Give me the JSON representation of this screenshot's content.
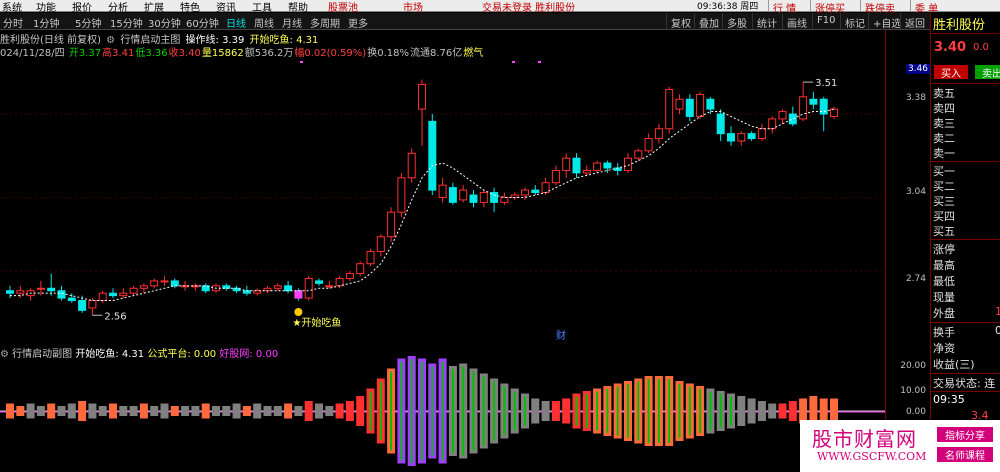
{
  "menu": {
    "items": [
      "系统",
      "功能",
      "报价",
      "分析",
      "扩展",
      "特色",
      "资讯",
      "工具",
      "帮助"
    ],
    "stock_pool": "股票池",
    "market": "市场",
    "status": "交易未登录   胜利股份",
    "clock": "09:36:38 周四",
    "right_buttons": [
      "行 情",
      "涨停买",
      "跌停卖",
      "委 单"
    ]
  },
  "toolbar": {
    "periods": [
      "分时",
      "1分钟",
      "5分钟",
      "15分钟",
      "30分钟",
      "60分钟",
      "日线",
      "周线",
      "月线",
      "多周期",
      "更多"
    ],
    "active_period": "日线",
    "right_tools": [
      "复权",
      "叠加",
      "多股",
      "统计",
      "画线",
      "F10",
      "标记",
      "+自选",
      "返回"
    ]
  },
  "main_chart": {
    "title": "胜利股份(日线 前复权)",
    "indicator": "行情启动主图",
    "op_line_label": "操作线: 3.39",
    "signal_label": "开始吃鱼: 4.31",
    "date": "024/11/28/四",
    "ohlc": [
      {
        "label": "开",
        "value": "3.37",
        "color": "#00d000"
      },
      {
        "label": "高",
        "value": "3.41",
        "color": "#ff4040"
      },
      {
        "label": "低",
        "value": "3.36",
        "color": "#00d000"
      },
      {
        "label": "收",
        "value": "3.40",
        "color": "#ff4040"
      },
      {
        "label": "量",
        "value": "15862",
        "color": "#ffff55"
      },
      {
        "label": "额",
        "value": "536.2万",
        "color": "#c0c0c0"
      },
      {
        "label": "幅",
        "value": "0.02(0.59%)",
        "color": "#ff4040"
      },
      {
        "label": "换",
        "value": "0.18%",
        "color": "#c0c0c0"
      },
      {
        "label": "流通",
        "value": "8.76亿",
        "color": "#c0c0c0"
      },
      {
        "label": "",
        "value": "燃气",
        "color": "#ffff55"
      }
    ],
    "y_ticks": [
      "3.38",
      "3.04",
      "2.74"
    ],
    "current_price_tag": "3.46",
    "annotations": {
      "high": "3.51",
      "low": "2.56",
      "signal": "开始吃鱼",
      "marker": "财"
    }
  },
  "indicator": {
    "title": "行情启动副图",
    "signal": "开始吃鱼: 4.31",
    "platform": "公式平台: 0.00",
    "net": "好股网: 0.00",
    "y_ticks": [
      "20.00",
      "10.00",
      "0.00"
    ]
  },
  "panel": {
    "name": "胜利股份",
    "price": "3.40",
    "change": "0.0",
    "buy": "买入",
    "sell": "卖出",
    "asks": [
      "卖五",
      "卖四",
      "卖三",
      "卖二",
      "卖一"
    ],
    "bids": [
      "买一",
      "买二",
      "买三",
      "买四",
      "买五"
    ],
    "stats": [
      "涨停",
      "最高",
      "最低",
      "现量",
      "外盘"
    ],
    "stat_values": [
      "",
      "",
      "",
      "",
      "1"
    ],
    "extra": [
      "换手",
      "净资",
      "收益(三)"
    ],
    "extra_values": [
      "0",
      "",
      ""
    ],
    "trade_state": "交易状态: 连",
    "time": "09:35",
    "tick_value": "3.4"
  },
  "watermark": {
    "title": "股市财富网",
    "url": "WWW.GSCFW.COM",
    "tag1": "指标分享",
    "tag2": "名师课程"
  },
  "chart_data": {
    "type": "candlestick",
    "y_range": [
      2.5,
      3.6
    ],
    "candles": [
      [
        2.66,
        2.65,
        2.68,
        2.63
      ],
      [
        2.65,
        2.66,
        2.68,
        2.63
      ],
      [
        2.64,
        2.66,
        2.67,
        2.62
      ],
      [
        2.67,
        2.67,
        2.7,
        2.64
      ],
      [
        2.67,
        2.66,
        2.73,
        2.64
      ],
      [
        2.66,
        2.63,
        2.68,
        2.62
      ],
      [
        2.63,
        2.62,
        2.65,
        2.61
      ],
      [
        2.62,
        2.58,
        2.64,
        2.57
      ],
      [
        2.59,
        2.62,
        2.63,
        2.56
      ],
      [
        2.62,
        2.65,
        2.66,
        2.61
      ],
      [
        2.65,
        2.64,
        2.67,
        2.63
      ],
      [
        2.64,
        2.65,
        2.67,
        2.63
      ],
      [
        2.65,
        2.67,
        2.68,
        2.64
      ],
      [
        2.67,
        2.68,
        2.69,
        2.65
      ],
      [
        2.68,
        2.7,
        2.71,
        2.67
      ],
      [
        2.7,
        2.7,
        2.72,
        2.68
      ],
      [
        2.7,
        2.68,
        2.71,
        2.67
      ],
      [
        2.68,
        2.68,
        2.7,
        2.66
      ],
      [
        2.68,
        2.68,
        2.69,
        2.66
      ],
      [
        2.68,
        2.66,
        2.69,
        2.65
      ],
      [
        2.66,
        2.68,
        2.69,
        2.65
      ],
      [
        2.68,
        2.67,
        2.69,
        2.66
      ],
      [
        2.67,
        2.66,
        2.68,
        2.65
      ],
      [
        2.66,
        2.65,
        2.68,
        2.64
      ],
      [
        2.65,
        2.66,
        2.67,
        2.64
      ],
      [
        2.66,
        2.67,
        2.68,
        2.65
      ],
      [
        2.67,
        2.68,
        2.69,
        2.66
      ],
      [
        2.68,
        2.66,
        2.7,
        2.65
      ],
      [
        2.66,
        2.63,
        2.67,
        2.62
      ],
      [
        2.63,
        2.71,
        2.72,
        2.62
      ],
      [
        2.7,
        2.69,
        2.71,
        2.68
      ],
      [
        2.68,
        2.68,
        2.7,
        2.67
      ],
      [
        2.68,
        2.71,
        2.72,
        2.67
      ],
      [
        2.71,
        2.73,
        2.74,
        2.7
      ],
      [
        2.73,
        2.77,
        2.78,
        2.72
      ],
      [
        2.77,
        2.82,
        2.83,
        2.76
      ],
      [
        2.82,
        2.88,
        2.89,
        2.8
      ],
      [
        2.88,
        2.98,
        3.0,
        2.86
      ],
      [
        2.98,
        3.12,
        3.14,
        2.96
      ],
      [
        3.12,
        3.22,
        3.24,
        3.1
      ],
      [
        3.4,
        3.5,
        3.52,
        3.25
      ],
      [
        3.35,
        3.07,
        3.38,
        3.05
      ],
      [
        3.04,
        3.09,
        3.12,
        3.02
      ],
      [
        3.08,
        3.02,
        3.1,
        3.01
      ],
      [
        3.03,
        3.07,
        3.09,
        3.02
      ],
      [
        3.05,
        3.02,
        3.07,
        3.0
      ],
      [
        3.02,
        3.06,
        3.07,
        3.0
      ],
      [
        3.06,
        3.02,
        3.08,
        2.98
      ],
      [
        3.02,
        3.04,
        3.06,
        3.01
      ],
      [
        3.04,
        3.05,
        3.06,
        3.03
      ],
      [
        3.05,
        3.07,
        3.08,
        3.03
      ],
      [
        3.07,
        3.06,
        3.09,
        3.05
      ],
      [
        3.06,
        3.1,
        3.12,
        3.05
      ],
      [
        3.1,
        3.15,
        3.17,
        3.09
      ],
      [
        3.15,
        3.2,
        3.22,
        3.12
      ],
      [
        3.2,
        3.14,
        3.22,
        3.12
      ],
      [
        3.14,
        3.15,
        3.17,
        3.13
      ],
      [
        3.15,
        3.18,
        3.19,
        3.14
      ],
      [
        3.18,
        3.16,
        3.19,
        3.14
      ],
      [
        3.16,
        3.15,
        3.18,
        3.13
      ],
      [
        3.15,
        3.2,
        3.22,
        3.14
      ],
      [
        3.2,
        3.23,
        3.24,
        3.19
      ],
      [
        3.23,
        3.28,
        3.3,
        3.22
      ],
      [
        3.28,
        3.32,
        3.34,
        3.26
      ],
      [
        3.32,
        3.48,
        3.49,
        3.3
      ],
      [
        3.4,
        3.44,
        3.46,
        3.38
      ],
      [
        3.44,
        3.37,
        3.46,
        3.35
      ],
      [
        3.37,
        3.46,
        3.47,
        3.36
      ],
      [
        3.44,
        3.4,
        3.45,
        3.38
      ],
      [
        3.38,
        3.3,
        3.4,
        3.27
      ],
      [
        3.3,
        3.27,
        3.33,
        3.25
      ],
      [
        3.27,
        3.3,
        3.31,
        3.25
      ],
      [
        3.3,
        3.28,
        3.31,
        3.27
      ],
      [
        3.28,
        3.32,
        3.34,
        3.27
      ],
      [
        3.32,
        3.36,
        3.37,
        3.3
      ],
      [
        3.36,
        3.39,
        3.4,
        3.34
      ],
      [
        3.38,
        3.34,
        3.41,
        3.33
      ],
      [
        3.36,
        3.45,
        3.51,
        3.35
      ],
      [
        3.44,
        3.42,
        3.47,
        3.4
      ],
      [
        3.44,
        3.38,
        3.45,
        3.31
      ],
      [
        3.37,
        3.4,
        3.41,
        3.36
      ]
    ],
    "ma": [
      2.64,
      2.64,
      2.65,
      2.65,
      2.65,
      2.65,
      2.64,
      2.63,
      2.62,
      2.62,
      2.62,
      2.63,
      2.64,
      2.65,
      2.66,
      2.67,
      2.68,
      2.68,
      2.68,
      2.68,
      2.67,
      2.67,
      2.67,
      2.66,
      2.66,
      2.66,
      2.66,
      2.66,
      2.66,
      2.66,
      2.67,
      2.67,
      2.68,
      2.69,
      2.7,
      2.73,
      2.77,
      2.84,
      2.93,
      3.03,
      3.12,
      3.17,
      3.18,
      3.16,
      3.13,
      3.1,
      3.07,
      3.05,
      3.04,
      3.04,
      3.04,
      3.05,
      3.06,
      3.08,
      3.1,
      3.12,
      3.13,
      3.14,
      3.15,
      3.16,
      3.17,
      3.19,
      3.21,
      3.24,
      3.28,
      3.31,
      3.34,
      3.37,
      3.39,
      3.39,
      3.37,
      3.35,
      3.33,
      3.32,
      3.32,
      3.34,
      3.36,
      3.38,
      3.39,
      3.39,
      3.4
    ],
    "indicator_range": [
      -10,
      25
    ],
    "osc": [
      [
        3,
        "#ff6a3d"
      ],
      [
        2,
        "#ff6a3d"
      ],
      [
        3,
        "#808080"
      ],
      [
        2,
        "#808080"
      ],
      [
        3,
        "#ff6a3d"
      ],
      [
        2,
        "#808080"
      ],
      [
        3,
        "#808080"
      ],
      [
        4,
        "#ff6a3d"
      ],
      [
        3,
        "#808080"
      ],
      [
        2,
        "#808080"
      ],
      [
        3,
        "#ff6a3d"
      ],
      [
        2,
        "#808080"
      ],
      [
        2,
        "#808080"
      ],
      [
        3,
        "#ff6a3d"
      ],
      [
        2,
        "#808080"
      ],
      [
        3,
        "#808080"
      ],
      [
        2,
        "#ff6a3d"
      ],
      [
        2,
        "#808080"
      ],
      [
        2,
        "#808080"
      ],
      [
        3,
        "#ff6a3d"
      ],
      [
        2,
        "#808080"
      ],
      [
        2,
        "#808080"
      ],
      [
        3,
        "#808080"
      ],
      [
        2,
        "#ff6a3d"
      ],
      [
        3,
        "#808080"
      ],
      [
        2,
        "#808080"
      ],
      [
        2,
        "#808080"
      ],
      [
        3,
        "#ff6a3d"
      ],
      [
        2,
        "#808080"
      ],
      [
        4,
        "#ff3030"
      ],
      [
        3,
        "#808080"
      ],
      [
        2,
        "#808080"
      ],
      [
        3,
        "#ff3030"
      ],
      [
        4,
        "#ff3030"
      ],
      [
        6,
        "#ff3030"
      ],
      [
        9,
        "#ff3030"
      ],
      [
        13,
        "#ff3030"
      ],
      [
        17,
        "#ff6a3d"
      ],
      [
        21,
        "#a040ff"
      ],
      [
        22,
        "#a040ff"
      ],
      [
        21,
        "#a040ff"
      ],
      [
        19,
        "#a040ff"
      ],
      [
        21,
        "#a040ff"
      ],
      [
        18,
        "#808080"
      ],
      [
        19,
        "#808080"
      ],
      [
        17,
        "#808080"
      ],
      [
        15,
        "#808080"
      ],
      [
        13,
        "#808080"
      ],
      [
        11,
        "#808080"
      ],
      [
        9,
        "#808080"
      ],
      [
        7,
        "#808080"
      ],
      [
        5,
        "#808080"
      ],
      [
        4,
        "#808080"
      ],
      [
        4,
        "#ff3030"
      ],
      [
        5,
        "#ff3030"
      ],
      [
        7,
        "#ff3030"
      ],
      [
        8,
        "#ff3030"
      ],
      [
        9,
        "#ff6a3d"
      ],
      [
        10,
        "#ff6a3d"
      ],
      [
        11,
        "#ff6a3d"
      ],
      [
        12,
        "#ff6a3d"
      ],
      [
        13,
        "#ff6a3d"
      ],
      [
        14,
        "#ff6a3d"
      ],
      [
        14,
        "#ff6a3d"
      ],
      [
        14,
        "#ff6a3d"
      ],
      [
        12,
        "#ff6a3d"
      ],
      [
        11,
        "#ff6a3d"
      ],
      [
        10,
        "#ff6a3d"
      ],
      [
        9,
        "#808080"
      ],
      [
        8,
        "#808080"
      ],
      [
        7,
        "#808080"
      ],
      [
        6,
        "#808080"
      ],
      [
        5,
        "#808080"
      ],
      [
        4,
        "#808080"
      ],
      [
        3,
        "#808080"
      ],
      [
        3,
        "#ff3030"
      ],
      [
        4,
        "#ff3030"
      ],
      [
        5,
        "#ff6a3d"
      ],
      [
        6,
        "#ff6a3d"
      ],
      [
        5,
        "#ff6a3d"
      ],
      [
        5,
        "#ff6a3d"
      ]
    ]
  }
}
